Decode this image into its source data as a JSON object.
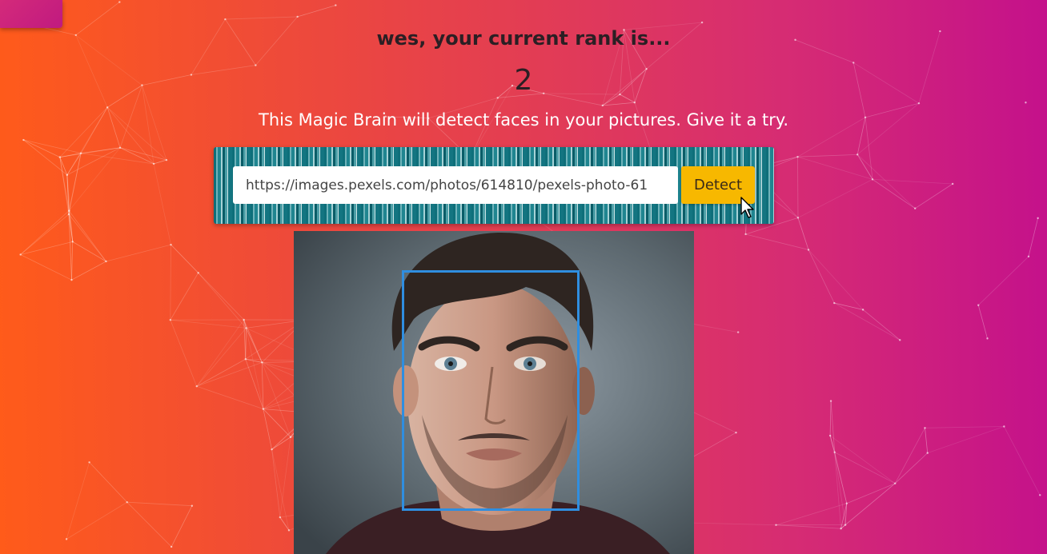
{
  "app": {
    "logo_icon": "brain-logo-icon"
  },
  "rank": {
    "heading": "wes, your current rank is...",
    "value": "2"
  },
  "tagline": "This Magic Brain will detect faces in your pictures. Give it a try.",
  "form": {
    "url_value": "https://images.pexels.com/photos/614810/pexels-photo-61",
    "button_label": "Detect"
  },
  "photo": {
    "alt": "portrait photo",
    "face_box_color": "#2f8ee0"
  },
  "colors": {
    "background_start": "#ff5b1a",
    "background_end": "#c4118b",
    "button": "#f7b800",
    "face_box": "#2f8ee0"
  }
}
